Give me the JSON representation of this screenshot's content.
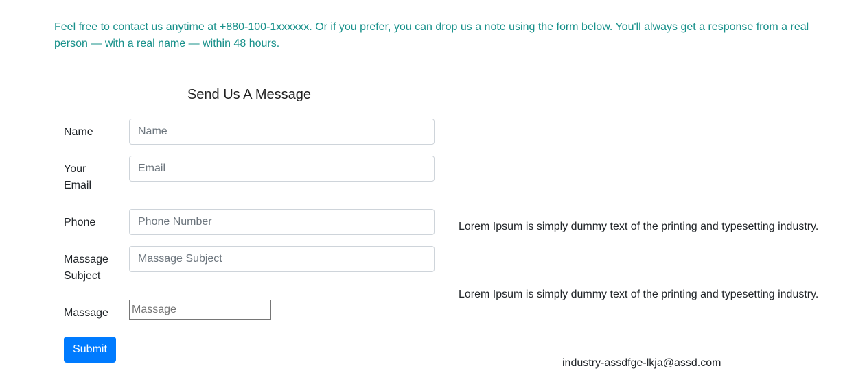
{
  "intro": {
    "text": "Feel free to contact us anytime at +880-100-1xxxxxx. Or if you prefer, you can drop us a note using the form below. You'll always get a response from a real person — with a real name — within 48 hours."
  },
  "form": {
    "title": "Send Us A Message",
    "name": {
      "label": "Name",
      "placeholder": "Name",
      "value": ""
    },
    "email": {
      "label": "Your Email",
      "placeholder": "Email",
      "value": ""
    },
    "phone": {
      "label": "Phone",
      "placeholder": "Phone Number",
      "value": ""
    },
    "subject": {
      "label": "Massage Subject",
      "placeholder": "Massage Subject",
      "value": ""
    },
    "message": {
      "label": "Massage",
      "placeholder": "Massage",
      "value": ""
    },
    "submit_label": "Submit"
  },
  "info": {
    "line1": "Lorem Ipsum is simply dummy text of the printing and typesetting industry.",
    "line2": "Lorem Ipsum is simply dummy text of the printing and typesetting industry.",
    "email": "industry-assdfge-lkja@assd.com"
  },
  "colors": {
    "intro_text": "#17908a",
    "primary_button": "#007bff",
    "input_border": "#ced4da"
  }
}
